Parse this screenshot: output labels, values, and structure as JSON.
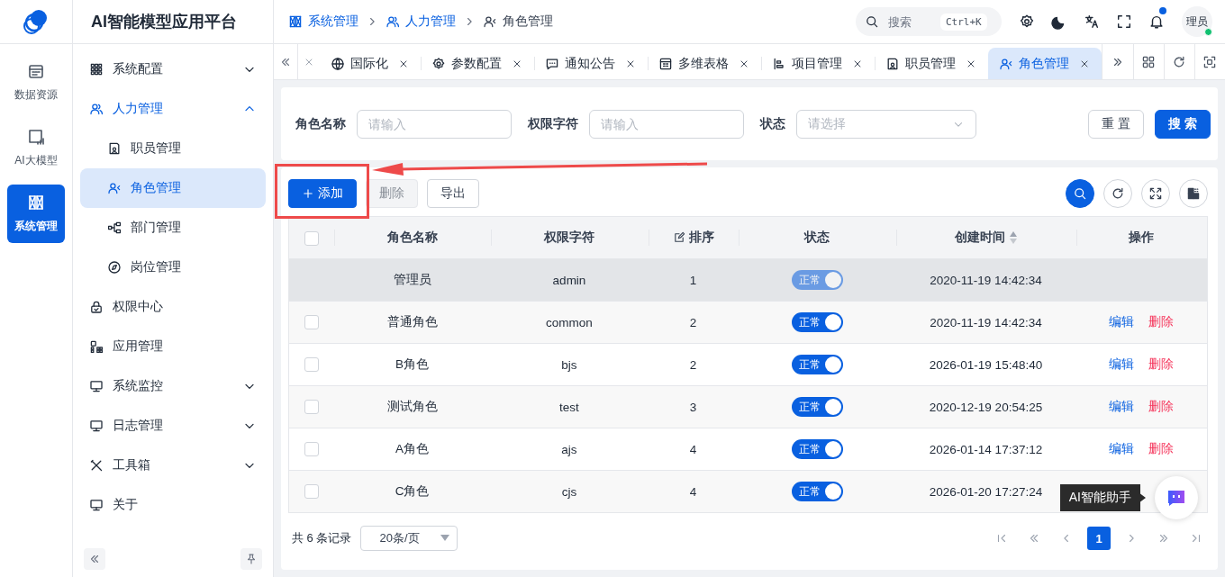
{
  "app": {
    "title": "AI智能模型应用平台"
  },
  "rail": [
    {
      "label": "数据资源",
      "selected": false
    },
    {
      "label": "AI大模型",
      "selected": false
    },
    {
      "label": "系统管理",
      "selected": true
    }
  ],
  "sidebar": {
    "items": [
      {
        "label": "系统配置",
        "kind": "group",
        "expanded": false,
        "selected": false
      },
      {
        "label": "人力管理",
        "kind": "group",
        "expanded": true,
        "selected": false,
        "children": [
          {
            "label": "职员管理",
            "selected": false
          },
          {
            "label": "角色管理",
            "selected": true
          },
          {
            "label": "部门管理",
            "selected": false
          },
          {
            "label": "岗位管理",
            "selected": false
          }
        ]
      },
      {
        "label": "权限中心",
        "kind": "link",
        "selected": false
      },
      {
        "label": "应用管理",
        "kind": "link",
        "selected": false
      },
      {
        "label": "系统监控",
        "kind": "group",
        "expanded": false,
        "selected": false
      },
      {
        "label": "日志管理",
        "kind": "group",
        "expanded": false,
        "selected": false
      },
      {
        "label": "工具箱",
        "kind": "group",
        "expanded": false,
        "selected": false
      },
      {
        "label": "关于",
        "kind": "link",
        "selected": false
      }
    ]
  },
  "breadcrumb": [
    "系统管理",
    "人力管理",
    "角色管理"
  ],
  "header": {
    "search_placeholder": "搜索",
    "shortcut": "Ctrl+K",
    "notification_dot": true,
    "avatar": "理员",
    "online": true
  },
  "tabs": [
    {
      "label": "国际化",
      "selected": false
    },
    {
      "label": "参数配置",
      "selected": false
    },
    {
      "label": "通知公告",
      "selected": false
    },
    {
      "label": "多维表格",
      "selected": false
    },
    {
      "label": "项目管理",
      "selected": false
    },
    {
      "label": "职员管理",
      "selected": false
    },
    {
      "label": "角色管理",
      "selected": true
    }
  ],
  "filters": [
    {
      "label": "角色名称",
      "kind": "input",
      "placeholder": "请输入"
    },
    {
      "label": "权限字符",
      "kind": "input",
      "placeholder": "请输入"
    },
    {
      "label": "状态",
      "kind": "select",
      "placeholder": "请选择"
    }
  ],
  "filter_buttons": [
    {
      "label": "重 置",
      "kind": "default"
    },
    {
      "label": "搜 索",
      "kind": "primary"
    }
  ],
  "toolbar": [
    {
      "label": "添加",
      "kind": "primary",
      "disabled": false
    },
    {
      "label": "删除",
      "kind": "default",
      "disabled": true
    },
    {
      "label": "导出",
      "kind": "default",
      "disabled": false
    }
  ],
  "table": {
    "select_all": {
      "checked": false
    },
    "columns": [
      {
        "label": "角色名称",
        "kind": "plain"
      },
      {
        "label": "权限字符",
        "kind": "plain"
      },
      {
        "label": "排序",
        "kind": "editable"
      },
      {
        "label": "状态",
        "kind": "plain"
      },
      {
        "label": "创建时间",
        "kind": "sortable"
      },
      {
        "label": "操作",
        "kind": "plain"
      }
    ],
    "rows": [
      {
        "name": "管理员",
        "key": "admin",
        "order": "1",
        "status": {
          "label": "正常",
          "on": true,
          "disabled": true
        },
        "created": "2020-11-19 14:42:34",
        "actions": [],
        "checkbox": false,
        "highlighted": true
      },
      {
        "name": "普通角色",
        "key": "common",
        "order": "2",
        "status": {
          "label": "正常",
          "on": true,
          "disabled": false
        },
        "created": "2020-11-19 14:42:34",
        "actions": [
          "编辑",
          "删除"
        ],
        "checkbox": true,
        "checked": false,
        "highlighted": false
      },
      {
        "name": "B角色",
        "key": "bjs",
        "order": "2",
        "status": {
          "label": "正常",
          "on": true,
          "disabled": false
        },
        "created": "2026-01-19 15:48:40",
        "actions": [
          "编辑",
          "删除"
        ],
        "checkbox": true,
        "checked": false,
        "highlighted": false
      },
      {
        "name": "测试角色",
        "key": "test",
        "order": "3",
        "status": {
          "label": "正常",
          "on": true,
          "disabled": false
        },
        "created": "2020-12-19 20:54:25",
        "actions": [
          "编辑",
          "删除"
        ],
        "checkbox": true,
        "checked": false,
        "highlighted": false
      },
      {
        "name": "A角色",
        "key": "ajs",
        "order": "4",
        "status": {
          "label": "正常",
          "on": true,
          "disabled": false
        },
        "created": "2026-01-14 17:37:12",
        "actions": [
          "编辑",
          "删除"
        ],
        "checkbox": true,
        "checked": false,
        "highlighted": false
      },
      {
        "name": "C角色",
        "key": "cjs",
        "order": "4",
        "status": {
          "label": "正常",
          "on": true,
          "disabled": false
        },
        "created": "2026-01-20 17:27:24",
        "actions": [],
        "checkbox": true,
        "checked": false,
        "highlighted": false
      }
    ]
  },
  "pagination": {
    "total": "共 6 条记录",
    "page_size": "20条/页",
    "pages": [
      {
        "label": "1",
        "selected": true
      }
    ]
  },
  "assistant": {
    "tooltip": "AI智能助手"
  }
}
